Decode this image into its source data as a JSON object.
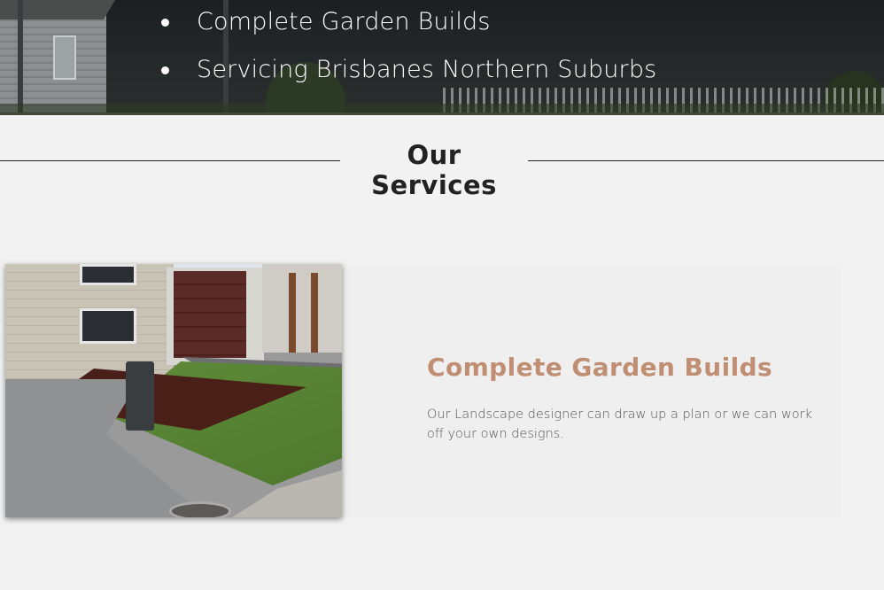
{
  "hero": {
    "bullets": [
      "Complete Garden Builds",
      "Servicing Brisbanes Northern Suburbs"
    ]
  },
  "services": {
    "heading": "Our Services",
    "items": [
      {
        "title": "Complete Garden Builds",
        "description": "Our Landscape designer can draw up a plan or we can work off your own designs.",
        "image_alt": "Front garden with mulched bed, lawn and letterbox beside a brick house with garage"
      }
    ]
  },
  "colors": {
    "accent_title": "#c08f73",
    "page_background": "#f2f2f2",
    "hero_border": "#3f4a35"
  }
}
